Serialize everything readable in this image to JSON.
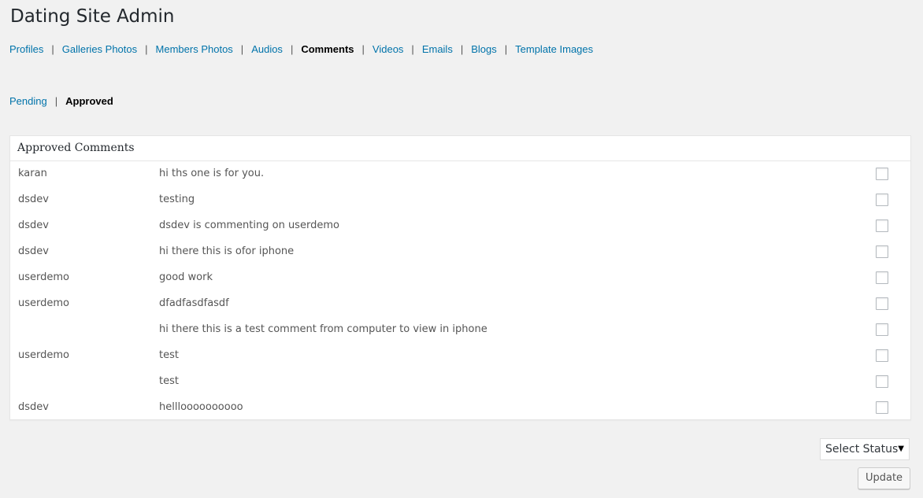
{
  "page": {
    "title": "Dating Site Admin"
  },
  "nav": {
    "items": [
      {
        "label": "Profiles",
        "current": false
      },
      {
        "label": "Galleries Photos",
        "current": false
      },
      {
        "label": "Members Photos",
        "current": false
      },
      {
        "label": "Audios",
        "current": false
      },
      {
        "label": "Comments",
        "current": true
      },
      {
        "label": "Videos",
        "current": false
      },
      {
        "label": "Emails",
        "current": false
      },
      {
        "label": "Blogs",
        "current": false
      },
      {
        "label": "Template Images",
        "current": false
      }
    ],
    "separator": "|"
  },
  "subnav": {
    "items": [
      {
        "label": "Pending",
        "current": false
      },
      {
        "label": "Approved",
        "current": true
      }
    ],
    "separator": "|"
  },
  "panel": {
    "title": "Approved Comments",
    "rows": [
      {
        "user": "karan",
        "comment": "hi ths one is for you.",
        "checked": false
      },
      {
        "user": "dsdev",
        "comment": "testing",
        "checked": false
      },
      {
        "user": "dsdev",
        "comment": "dsdev is commenting on userdemo",
        "checked": false
      },
      {
        "user": "dsdev",
        "comment": "hi there this is ofor iphone",
        "checked": false
      },
      {
        "user": "userdemo",
        "comment": "good work",
        "checked": false
      },
      {
        "user": "userdemo",
        "comment": "dfadfasdfasdf",
        "checked": false
      },
      {
        "user": "",
        "comment": "hi there this is a test comment from computer to view in iphone",
        "checked": false
      },
      {
        "user": "userdemo",
        "comment": "test",
        "checked": false
      },
      {
        "user": "",
        "comment": "test",
        "checked": false
      },
      {
        "user": "dsdev",
        "comment": "hellloooooooooo",
        "checked": false
      }
    ]
  },
  "actions": {
    "status_select": {
      "selected": "Select Status",
      "arrow_icon": "caret-down-icon"
    },
    "update_label": "Update"
  },
  "colors": {
    "link": "#0073aa",
    "background": "#f1f1f1"
  }
}
